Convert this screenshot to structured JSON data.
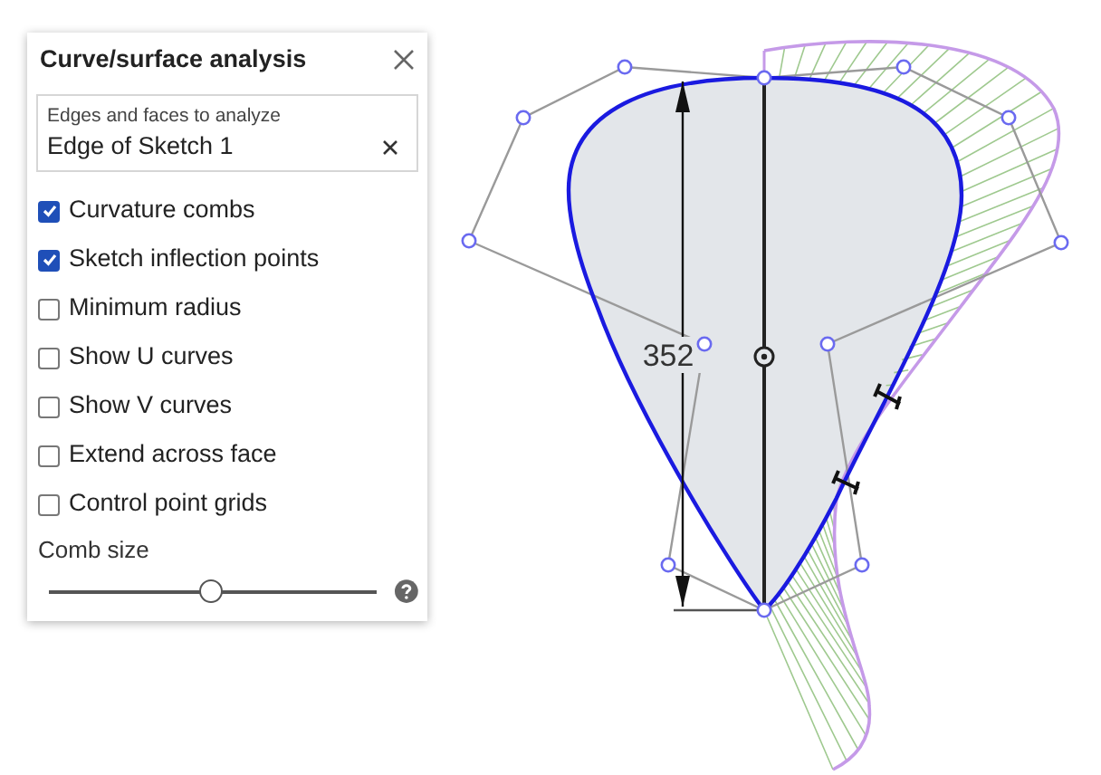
{
  "panel": {
    "title": "Curve/surface analysis",
    "selection_field": {
      "label": "Edges and faces to analyze",
      "value": "Edge of Sketch 1"
    },
    "options": [
      {
        "label": "Curvature combs",
        "checked": true
      },
      {
        "label": "Sketch inflection points",
        "checked": true
      },
      {
        "label": "Minimum radius",
        "checked": false
      },
      {
        "label": "Show U curves",
        "checked": false
      },
      {
        "label": "Show V curves",
        "checked": false
      },
      {
        "label": "Extend across face",
        "checked": false
      },
      {
        "label": "Control point grids",
        "checked": false
      }
    ],
    "comb_size": {
      "label": "Comb size",
      "level": 0.49
    }
  },
  "canvas": {
    "dimension": "352"
  }
}
